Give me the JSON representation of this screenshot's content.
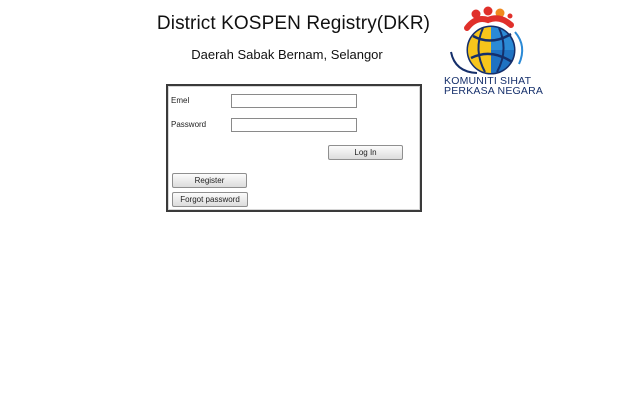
{
  "header": {
    "title": "District KOSPEN Registry(DKR)",
    "subtitle": "Daerah Sabak Bernam, Selangor"
  },
  "logo": {
    "icon": "komuniti-sihat-logo-icon",
    "line1": "KOMUNITI SIHAT",
    "line2": "PERKASA NEGARA",
    "colors": {
      "navy": "#152f6b",
      "yellow": "#f6c51b",
      "blue": "#2b8ad6",
      "red": "#e0302b",
      "orange": "#f08a1e"
    }
  },
  "login": {
    "email_label": "Emel",
    "email_value": "",
    "password_label": "Password",
    "password_value": "",
    "login_button": "Log In",
    "register_button": "Register",
    "forgot_button": "Forgot password"
  }
}
